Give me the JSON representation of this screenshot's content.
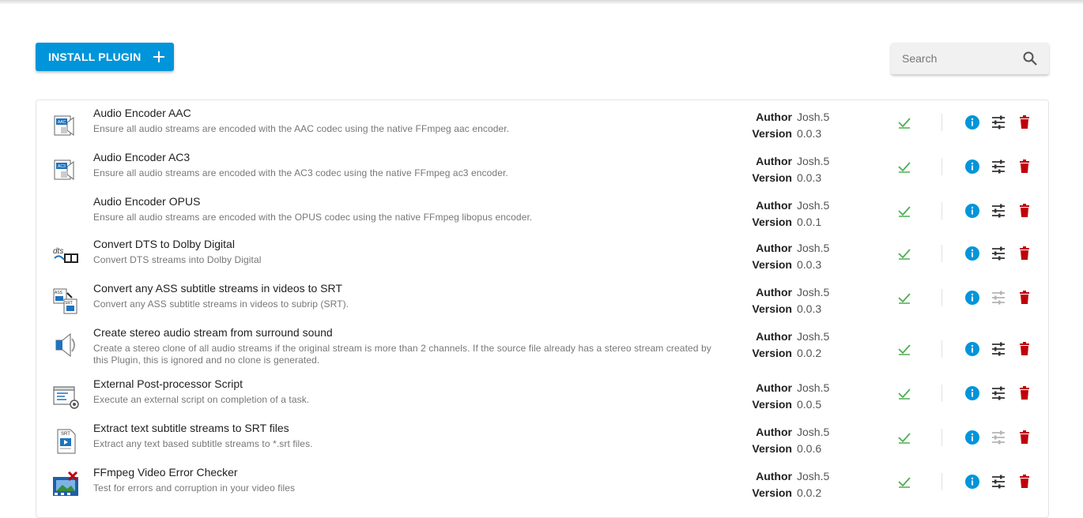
{
  "toolbar": {
    "install_label": "INSTALL PLUGIN",
    "search_placeholder": "Search"
  },
  "labels": {
    "author": "Author",
    "version": "Version"
  },
  "colors": {
    "primary": "#0095da",
    "enabled_check": "#4caf50",
    "delete": "#c0000c",
    "settings_disabled": "#b5b5b5"
  },
  "plugins": [
    {
      "name": "Audio Encoder AAC",
      "description": "Ensure all audio streams are encoded with the AAC codec using the native FFmpeg aac encoder.",
      "author": "Josh.5",
      "version": "0.0.3",
      "icon": "audio-aac-icon",
      "settings_enabled": true
    },
    {
      "name": "Audio Encoder AC3",
      "description": "Ensure all audio streams are encoded with the AC3 codec using the native FFmpeg ac3 encoder.",
      "author": "Josh.5",
      "version": "0.0.3",
      "icon": "audio-ac3-icon",
      "settings_enabled": true
    },
    {
      "name": "Audio Encoder OPUS",
      "description": "Ensure all audio streams are encoded with the OPUS codec using the native FFmpeg libopus encoder.",
      "author": "Josh.5",
      "version": "0.0.1",
      "icon": "",
      "settings_enabled": true
    },
    {
      "name": "Convert DTS to Dolby Digital",
      "description": "Convert DTS streams into Dolby Digital",
      "author": "Josh.5",
      "version": "0.0.3",
      "icon": "dts-dolby-icon",
      "settings_enabled": true
    },
    {
      "name": "Convert any ASS subtitle streams in videos to SRT",
      "description": "Convert any ASS subtitle streams in videos to subrip (SRT).",
      "author": "Josh.5",
      "version": "0.0.3",
      "icon": "ass-to-srt-icon",
      "settings_enabled": false
    },
    {
      "name": "Create stereo audio stream from surround sound",
      "description": "Create a stereo clone of all audio streams if the original stream is more than 2 channels. If the source file already has a stereo stream created by this Plugin, this is ignored and no clone is generated.",
      "author": "Josh.5",
      "version": "0.0.2",
      "icon": "stereo-speaker-icon",
      "settings_enabled": true
    },
    {
      "name": "External Post-processor Script",
      "description": "Execute an external script on completion of a task.",
      "author": "Josh.5",
      "version": "0.0.5",
      "icon": "script-window-icon",
      "settings_enabled": true
    },
    {
      "name": "Extract text subtitle streams to SRT files",
      "description": "Extract any text based subtitle streams to *.srt files.",
      "author": "Josh.5",
      "version": "0.0.6",
      "icon": "srt-extract-icon",
      "settings_enabled": false
    },
    {
      "name": "FFmpeg Video Error Checker",
      "description": "Test for errors and corruption in your video files",
      "author": "Josh.5",
      "version": "0.0.2",
      "icon": "video-error-icon",
      "settings_enabled": true
    }
  ]
}
